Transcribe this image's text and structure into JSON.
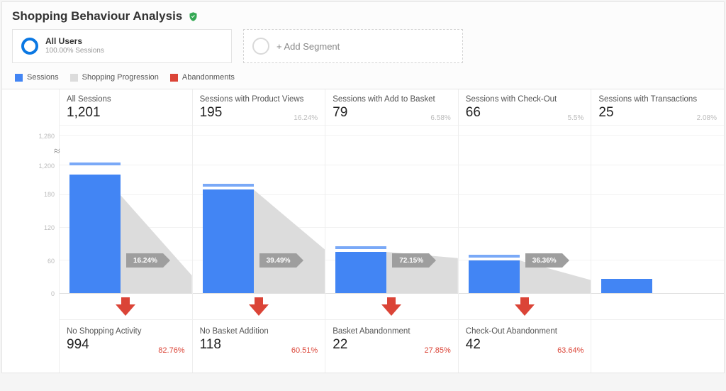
{
  "title": "Shopping Behaviour Analysis",
  "segments": {
    "primary": {
      "title": "All Users",
      "subtitle": "100.00% Sessions"
    },
    "add_label": "+ Add Segment"
  },
  "legend": {
    "sessions": "Sessions",
    "progression": "Shopping Progression",
    "abandonments": "Abandonments"
  },
  "axis": {
    "ticks": [
      "1,280",
      "1,200",
      "180",
      "120",
      "60",
      "0"
    ]
  },
  "chart_data": {
    "type": "bar",
    "title": "Shopping Behaviour Analysis",
    "ylabel": "Sessions",
    "ylim": [
      0,
      1280
    ],
    "stages": [
      {
        "label": "All Sessions",
        "value_str": "1,201",
        "value": 1201,
        "pct_of_total": null,
        "progression_pct": "16.24%",
        "abandonment": {
          "label": "No Shopping Activity",
          "value_str": "994",
          "value": 994,
          "pct": "82.76%"
        }
      },
      {
        "label": "Sessions with Product Views",
        "value_str": "195",
        "value": 195,
        "pct_of_total": "16.24%",
        "progression_pct": "39.49%",
        "abandonment": {
          "label": "No Basket Addition",
          "value_str": "118",
          "value": 118,
          "pct": "60.51%"
        }
      },
      {
        "label": "Sessions with Add to Basket",
        "value_str": "79",
        "value": 79,
        "pct_of_total": "6.58%",
        "progression_pct": "72.15%",
        "abandonment": {
          "label": "Basket Abandonment",
          "value_str": "22",
          "value": 22,
          "pct": "27.85%"
        }
      },
      {
        "label": "Sessions with Check-Out",
        "value_str": "66",
        "value": 66,
        "pct_of_total": "5.5%",
        "progression_pct": "36.36%",
        "abandonment": {
          "label": "Check-Out Abandonment",
          "value_str": "42",
          "value": 42,
          "pct": "63.64%"
        }
      },
      {
        "label": "Sessions with Transactions",
        "value_str": "25",
        "value": 25,
        "pct_of_total": "2.08%",
        "progression_pct": null,
        "abandonment": null
      }
    ]
  },
  "colors": {
    "sessions": "#4285f4",
    "progression": "#dcdcdc",
    "abandonment": "#db4437",
    "verified": "#34a853"
  }
}
